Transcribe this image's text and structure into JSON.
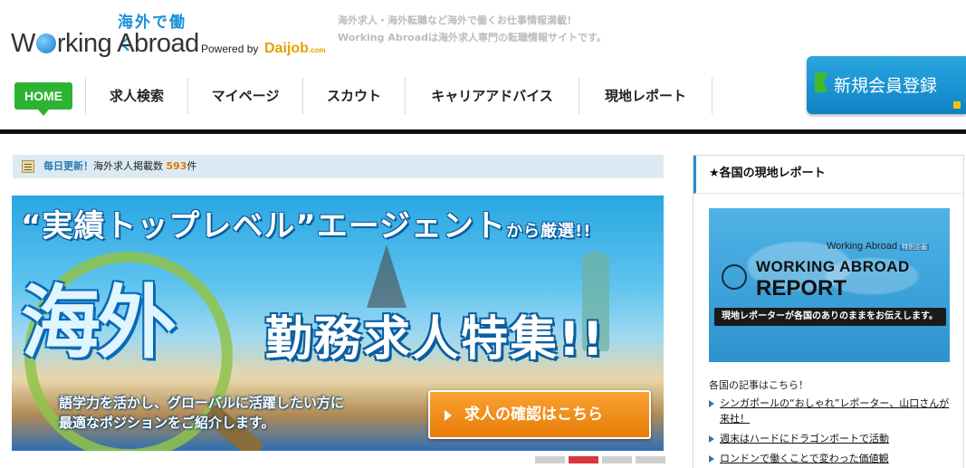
{
  "header": {
    "logo_jp": "海外で働く",
    "logo_en_prefix": "W",
    "logo_en_rest": "rking Abroad",
    "powered_by": "Powered by",
    "daijob": "Daijob",
    "daijob_suffix": ".com",
    "tagline_1": "海外求人・海外転職など海外で働くお仕事情報満載！",
    "tagline_2": "Working Abroadは海外求人専門の転職情報サイトです。",
    "signup_label": "新規会員登録"
  },
  "nav": {
    "home": "HOME",
    "items": [
      "求人検索",
      "マイページ",
      "スカウト",
      "キャリアアドバイス",
      "現地レポート"
    ]
  },
  "updates": {
    "daily": "毎日更新！",
    "label": "海外求人掲載数",
    "count": "593",
    "unit": "件"
  },
  "banner": {
    "title1_main": "“実績トップレベル”エージェント",
    "title1_small": "から厳選!!",
    "hero": "海外",
    "title2": "勤務求人特集!!",
    "desc_1": "語学力を活かし、グローバルに活躍したい方に",
    "desc_2": "最適なポジションをご紹介します。",
    "cta": "求人の確認はこちら"
  },
  "carousel": {
    "count": 4,
    "active_index": 1
  },
  "sidebar": {
    "heading": "★各国の現地レポート",
    "card_brand": "Working Abroad",
    "card_brand_tag": "特別企画",
    "card_line1": "WORKING ABROAD",
    "card_line2": "REPORT",
    "card_strip": "現地レポーターが各国のありのままをお伝えします。",
    "intro": "各国の記事はこちら！",
    "links": [
      "シンガポールの“おしゃれ”レポーター、山口さんが来社！",
      "週末はハードにドラゴンボートで活動",
      "ロンドンで働くことで変わった価値観"
    ]
  },
  "colors": {
    "accent_blue": "#2a8fd0",
    "home_green": "#2db333",
    "cta_orange": "#e97c06",
    "count_orange": "#e07b00",
    "active_dot": "#d9373b"
  }
}
